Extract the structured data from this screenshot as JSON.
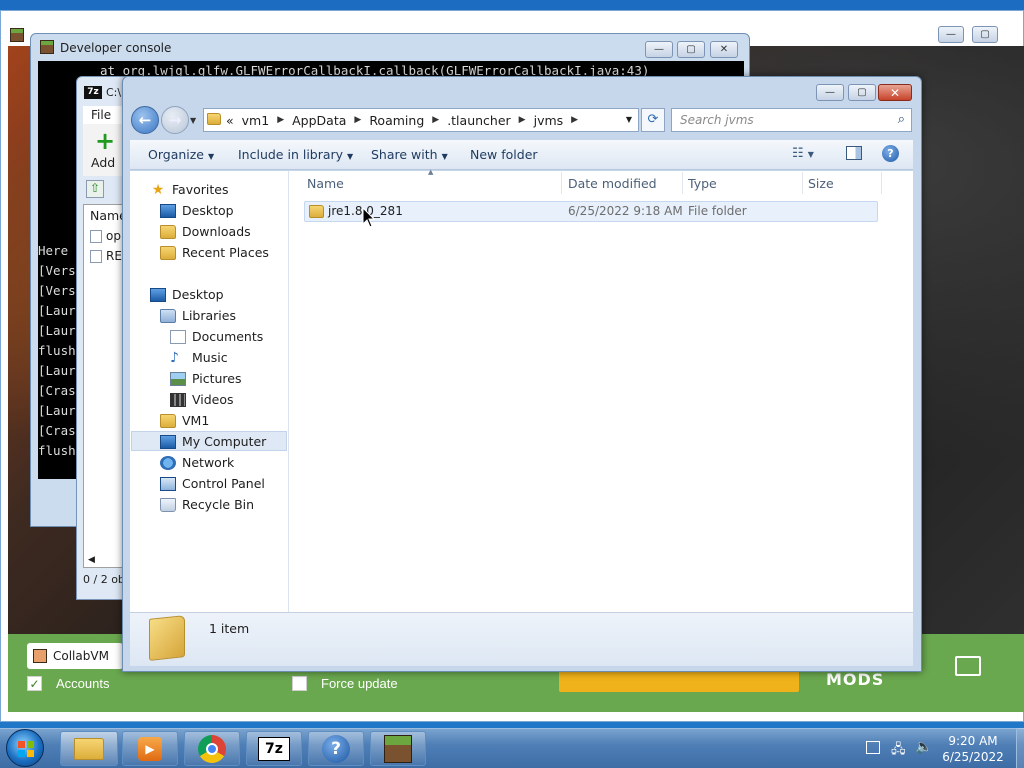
{
  "launcher": {
    "account_name": "CollabVM",
    "accounts_label": "Accounts",
    "force_update_label": "Force update",
    "mods_logo": "MODS"
  },
  "developer_console": {
    "title": "Developer console",
    "top_line": "at org.lwjgl.glfw.GLFWErrorCallbackI.callback(GLFWErrorCallbackI.java:43)",
    "lines": [
      "Here",
      "[Vers",
      "[Vers",
      "[Laur",
      "[Laur",
      "flush",
      "[Laur",
      "[Cras",
      "[Laur",
      "[Cras",
      "flush"
    ]
  },
  "sevenzip": {
    "title": "C:\\",
    "menu_file": "File",
    "add_label": "Add",
    "column_name": "Name",
    "files": [
      "op",
      "REA"
    ],
    "status": "0 / 2 ob"
  },
  "explorer": {
    "breadcrumb": [
      "vm1",
      "AppData",
      "Roaming",
      ".tlauncher",
      "jvms"
    ],
    "breadcrumb_prefix": "«",
    "search_placeholder": "Search jvms",
    "toolbar": {
      "organize": "Organize",
      "include_in_library": "Include in library",
      "share_with": "Share with",
      "new_folder": "New folder"
    },
    "nav": {
      "favorites": "Favorites",
      "favorites_items": [
        "Desktop",
        "Downloads",
        "Recent Places"
      ],
      "desktop": "Desktop",
      "libraries": "Libraries",
      "libraries_items": [
        "Documents",
        "Music",
        "Pictures",
        "Videos"
      ],
      "vm1": "VM1",
      "my_computer": "My Computer",
      "network": "Network",
      "control_panel": "Control Panel",
      "recycle_bin": "Recycle Bin"
    },
    "columns": [
      "Name",
      "Date modified",
      "Type",
      "Size"
    ],
    "rows": [
      {
        "name": "jre1.8.0_281",
        "date": "6/25/2022 9:18 AM",
        "type": "File folder",
        "size": ""
      }
    ],
    "status_text": "1 item"
  },
  "taskbar": {
    "time": "9:20 AM",
    "date": "6/25/2022",
    "apps": [
      "explorer-icon",
      "media-player-icon",
      "chrome-icon",
      "7zip-icon",
      "help-icon",
      "minecraft-icon"
    ],
    "sevenzip_label": "7z"
  },
  "colors": {
    "launcher_green": "#6aa84f",
    "launcher_button": "#f0b21b",
    "taskbar_blue": "#4f7fb6",
    "selection": "#e8f1fb"
  }
}
